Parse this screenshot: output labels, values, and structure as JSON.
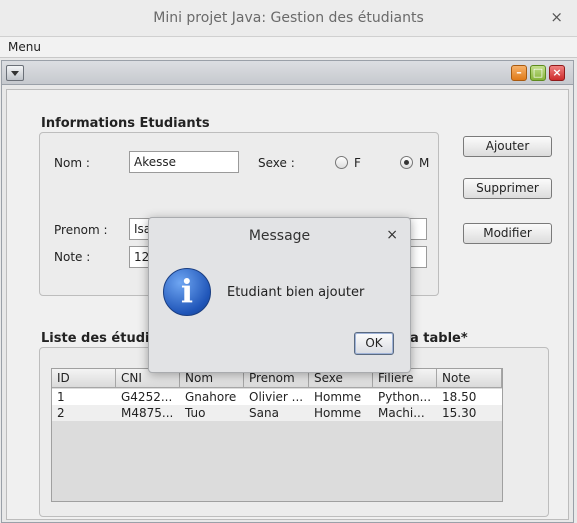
{
  "window": {
    "title": "Mini projet Java: Gestion des étudiants",
    "close_glyph": "×"
  },
  "menubar": {
    "items": [
      "Menu"
    ]
  },
  "internal_frame": {
    "min_glyph": "–",
    "max_glyph": "□",
    "close_glyph": "×"
  },
  "form": {
    "title": "Informations Etudiants",
    "nom_label": "Nom :",
    "nom_value": "Akesse",
    "sexe_label": "Sexe :",
    "sexe_options": [
      "F",
      "M"
    ],
    "sexe_selected": "M",
    "prenom_label": "Prenom :",
    "prenom_value": "Isa",
    "note_label": "Note :",
    "note_value": "12."
  },
  "actions": {
    "add": "Ajouter",
    "delete": "Supprimer",
    "edit": "Modifier"
  },
  "list": {
    "title_left": "Liste des étudi",
    "title_right": "a table*",
    "columns": [
      "ID",
      "CNI",
      "Nom",
      "Prenom",
      "Sexe",
      "Filiere",
      "Note"
    ],
    "rows": [
      [
        "1",
        "G4252...",
        "Gnahore",
        "Olivier ...",
        "Homme",
        "Python...",
        "18.50"
      ],
      [
        "2",
        "M4875...",
        "Tuo",
        "Sana",
        "Homme",
        "Machi...",
        "15.30"
      ]
    ]
  },
  "dialog": {
    "title": "Message",
    "close_glyph": "×",
    "icon": "info-icon",
    "icon_glyph": "i",
    "message": "Etudiant bien ajouter",
    "ok": "OK"
  },
  "colors": {
    "info_blue": "#1f55b8",
    "min_orange": "#e07a18",
    "max_green": "#86b33a",
    "close_red": "#cc2b2b"
  }
}
